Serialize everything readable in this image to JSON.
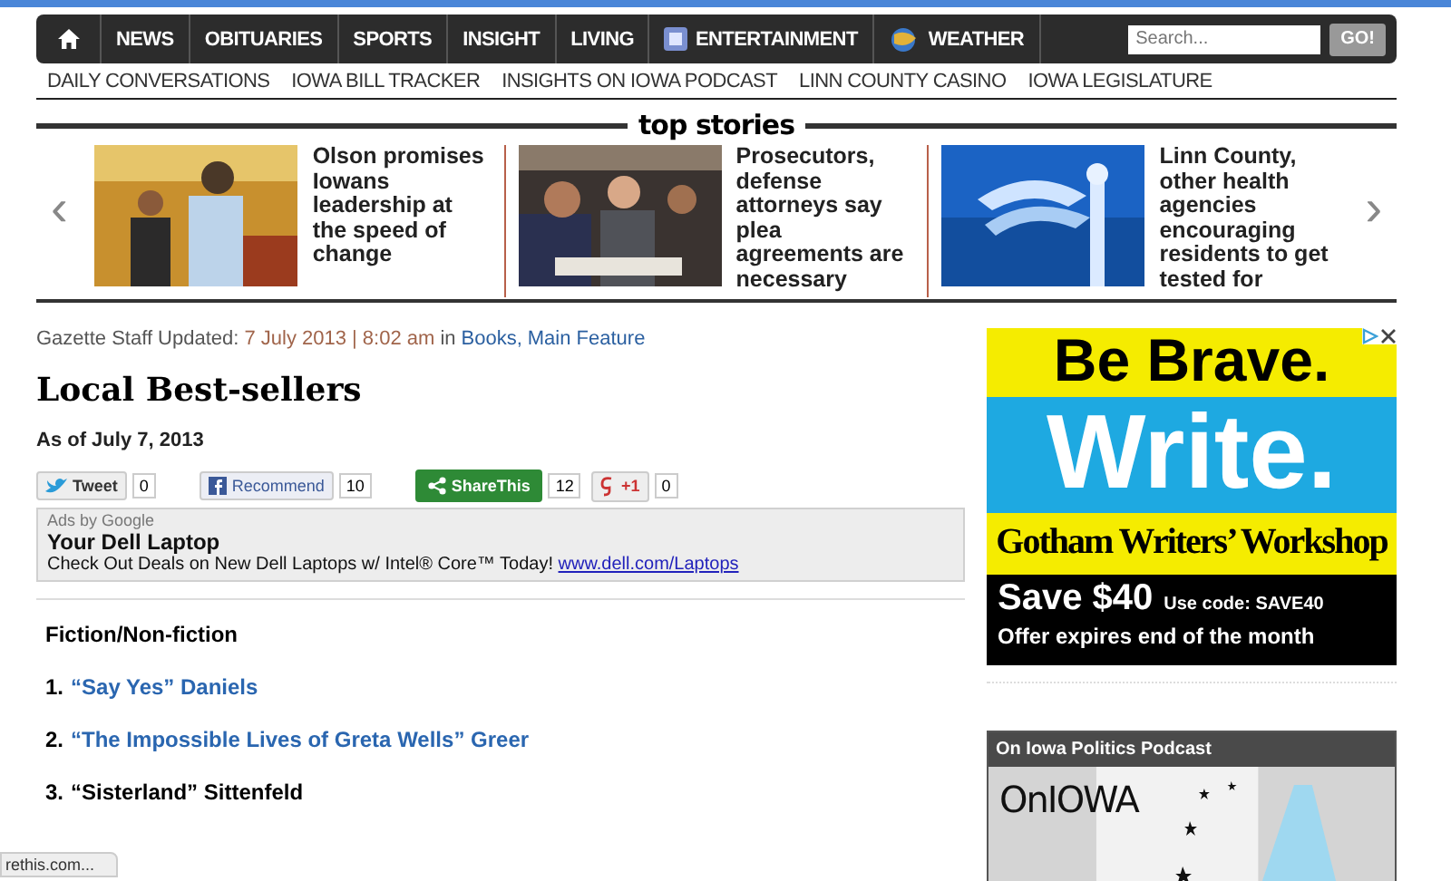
{
  "nav": {
    "items": [
      {
        "label": "NEWS"
      },
      {
        "label": "OBITUARIES"
      },
      {
        "label": "SPORTS"
      },
      {
        "label": "INSIGHT"
      },
      {
        "label": "LIVING"
      },
      {
        "label": "ENTERTAINMENT"
      },
      {
        "label": "WEATHER"
      }
    ],
    "search": {
      "placeholder": "Search...",
      "button": "GO!"
    }
  },
  "subnav": [
    "DAILY CONVERSATIONS",
    "IOWA BILL TRACKER",
    "INSIGHTS ON IOWA PODCAST",
    "LINN COUNTY CASINO",
    "IOWA LEGISLATURE"
  ],
  "top_stories": {
    "title": "top stories",
    "prev": "‹",
    "next": "›",
    "stories": [
      {
        "headline": "Olson promises Iowans leadership at the speed of change",
        "kind": "picture"
      },
      {
        "headline": "Prosecutors, defense attorneys say plea agreements are necessary",
        "kind": "picture"
      },
      {
        "headline": "Linn County, other health agencies encouraging residents to get tested for",
        "kind": "picture"
      }
    ]
  },
  "article": {
    "byline": "Gazette Staff Updated:",
    "date": "7 July 2013 | 8:02 am",
    "in": "in",
    "categories": [
      "Books,",
      "Main Feature"
    ],
    "title": "Local Best-sellers",
    "subtitle": "As of July 7, 2013",
    "share": [
      {
        "label": "Tweet",
        "count": "0"
      },
      {
        "label": "Recommend",
        "count": "10"
      },
      {
        "label": "ShareThis",
        "count": "12"
      },
      {
        "label": "+1",
        "count": "0"
      }
    ],
    "ad": {
      "source": "Ads by Google",
      "title": "Your Dell Laptop",
      "text": "Check Out Deals on New Dell Laptops w/ Intel® Core™ Today!",
      "link": "www.dell.com/Laptops"
    },
    "section": "Fiction/Non-fiction",
    "books": [
      {
        "number": "1.",
        "title": "“Say Yes” Daniels",
        "linked": true
      },
      {
        "number": "2.",
        "title": "“The Impossible Lives of Greta Wells” Greer",
        "linked": true
      },
      {
        "number": "3.",
        "title": "“Sisterland” Sittenfeld",
        "linked": false
      }
    ]
  },
  "sidebar_ad": {
    "line1": "Be Brave.",
    "line2": "Write.",
    "line3": "Gotham Writers’ Workshop",
    "offer": "Save $40",
    "code": "Use code: SAVE40",
    "expires": "Offer expires end of the month"
  },
  "podcast": {
    "title": "On Iowa Politics Podcast",
    "logo": "OnIOWA"
  },
  "status_bar": "rethis.com..."
}
